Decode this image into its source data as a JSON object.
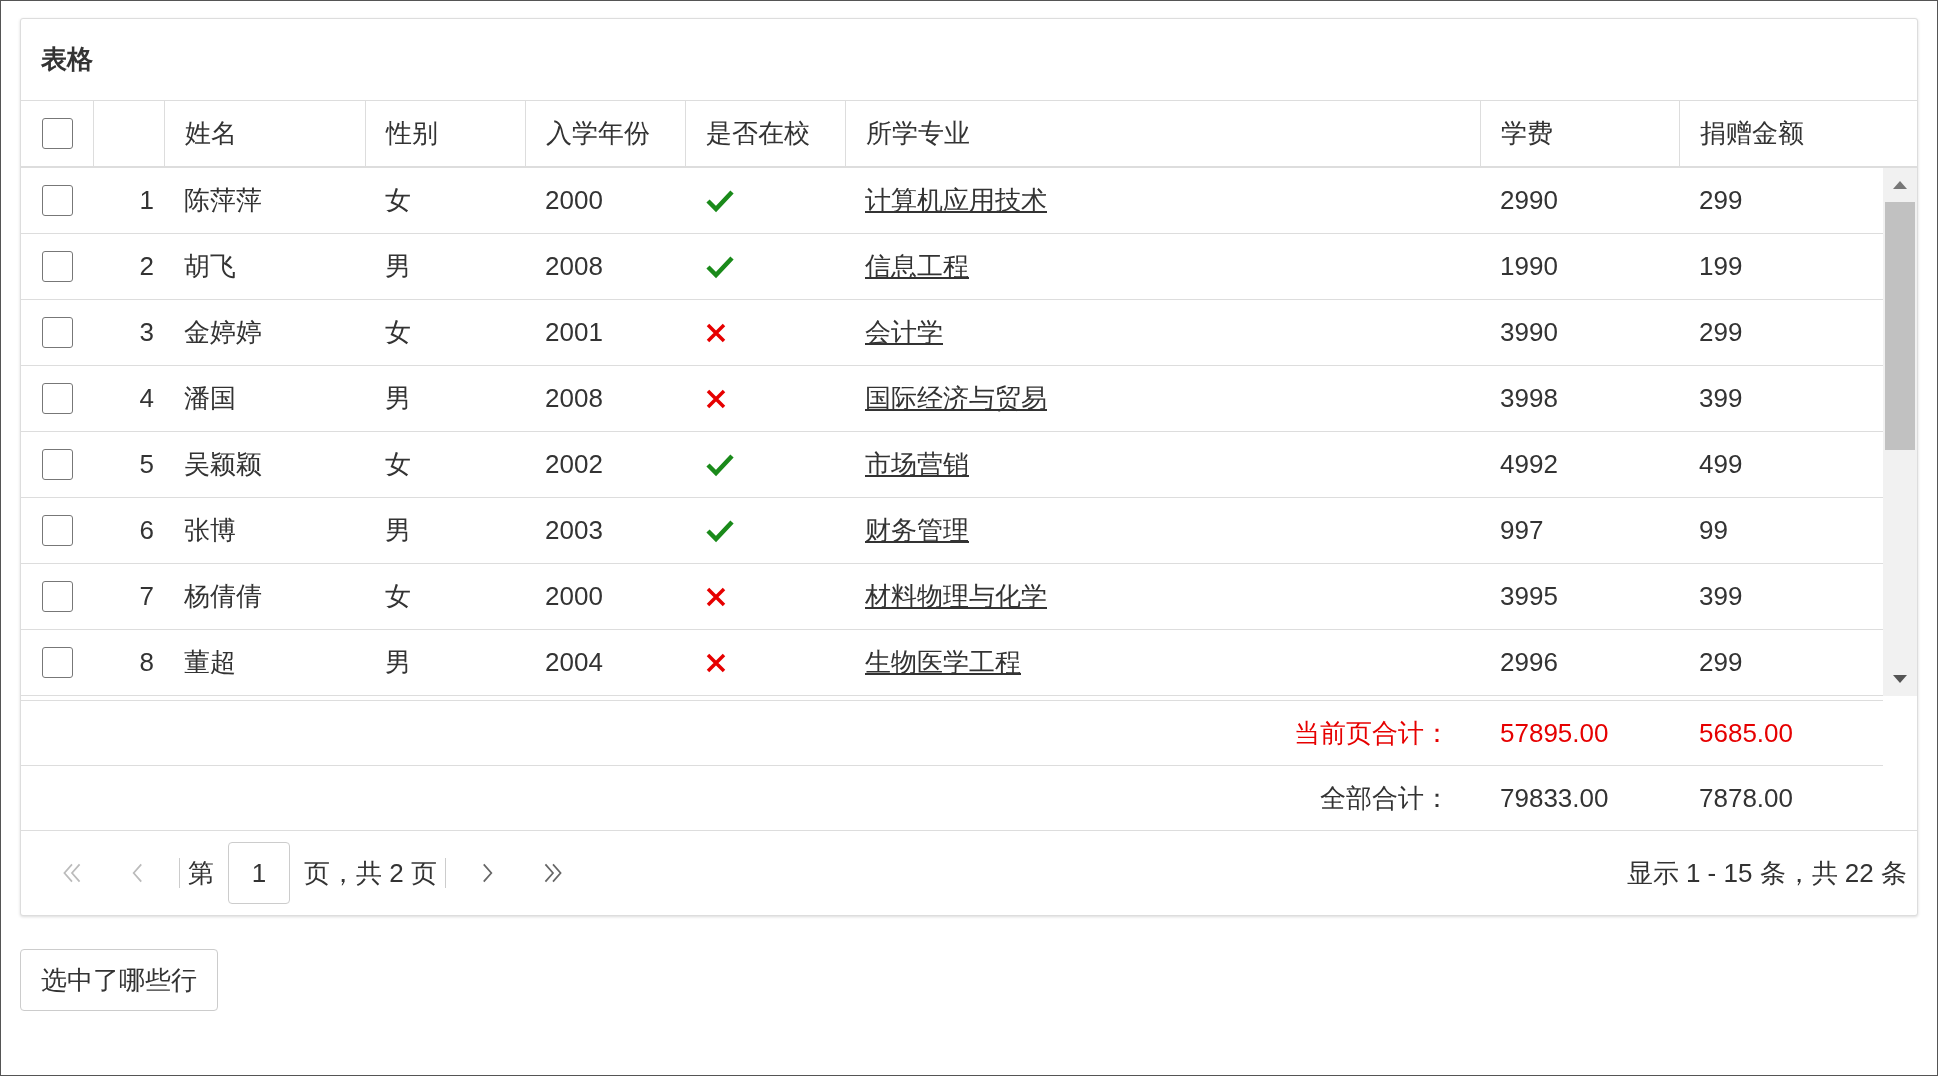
{
  "panel": {
    "title": "表格"
  },
  "table": {
    "select_all": {
      "checked": false
    },
    "columns": [
      "姓名",
      "性别",
      "入学年份",
      "是否在校",
      "所学专业",
      "学费",
      "捐赠金额"
    ],
    "rows": [
      {
        "checked": false,
        "index": "1",
        "name": "陈萍萍",
        "gender": "女",
        "year": "2000",
        "in_school": true,
        "major": "计算机应用技术",
        "fee": "2990",
        "donation": "299"
      },
      {
        "checked": false,
        "index": "2",
        "name": "胡飞",
        "gender": "男",
        "year": "2008",
        "in_school": true,
        "major": "信息工程",
        "fee": "1990",
        "donation": "199"
      },
      {
        "checked": false,
        "index": "3",
        "name": "金婷婷",
        "gender": "女",
        "year": "2001",
        "in_school": false,
        "major": "会计学",
        "fee": "3990",
        "donation": "299"
      },
      {
        "checked": false,
        "index": "4",
        "name": "潘国",
        "gender": "男",
        "year": "2008",
        "in_school": false,
        "major": "国际经济与贸易",
        "fee": "3998",
        "donation": "399"
      },
      {
        "checked": false,
        "index": "5",
        "name": "吴颖颖",
        "gender": "女",
        "year": "2002",
        "in_school": true,
        "major": "市场营销",
        "fee": "4992",
        "donation": "499"
      },
      {
        "checked": false,
        "index": "6",
        "name": "张博",
        "gender": "男",
        "year": "2003",
        "in_school": true,
        "major": "财务管理",
        "fee": "997",
        "donation": "99"
      },
      {
        "checked": false,
        "index": "7",
        "name": "杨倩倩",
        "gender": "女",
        "year": "2000",
        "in_school": false,
        "major": "材料物理与化学",
        "fee": "3995",
        "donation": "399"
      },
      {
        "checked": false,
        "index": "8",
        "name": "董超",
        "gender": "男",
        "year": "2004",
        "in_school": false,
        "major": "生物医学工程",
        "fee": "2996",
        "donation": "299"
      }
    ],
    "summary": [
      {
        "kind": "page",
        "label": "当前页合计：",
        "fee": "57895.00",
        "donation": "5685.00"
      },
      {
        "kind": "all",
        "label": "全部合计：",
        "fee": "79833.00",
        "donation": "7878.00"
      }
    ]
  },
  "pager": {
    "buttons_before": [
      {
        "kind": "first",
        "disabled": true
      },
      {
        "kind": "prev",
        "disabled": true
      }
    ],
    "label_before": "第",
    "page_input": {
      "value": "1"
    },
    "label_after": "页，共 2 页",
    "buttons_after": [
      {
        "kind": "next",
        "disabled": false
      },
      {
        "kind": "last",
        "disabled": false
      }
    ],
    "info": "显示 1 - 15 条，共 22 条"
  },
  "action_button": {
    "label": "选中了哪些行"
  }
}
